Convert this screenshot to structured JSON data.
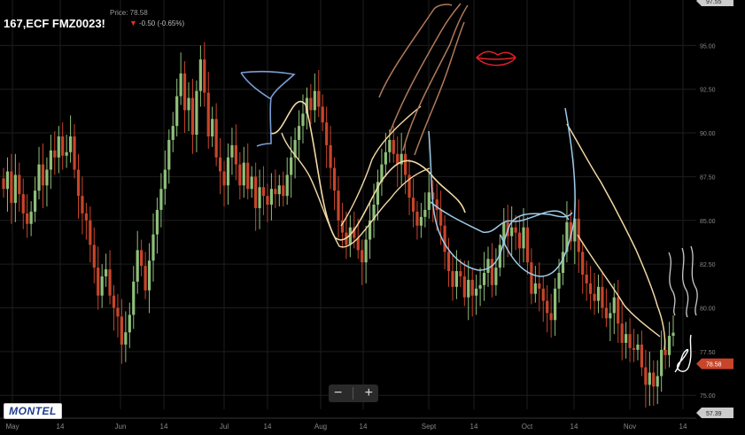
{
  "header": {
    "title": "167,ECF FMZ0023!",
    "price_label": "Price: 78.58",
    "change_text": "-0.50 (-0.65%)",
    "change_arrow": "down-arrow-icon"
  },
  "zoom": {
    "minus": "−",
    "plus": "+"
  },
  "logo": {
    "text": "MONTEL"
  },
  "colors": {
    "up": "#8fbf7a",
    "down": "#c8452a",
    "grid": "#1e1e1e",
    "axis_text": "#888"
  },
  "chart_data": {
    "type": "candlestick",
    "title": "167,ECF FMZ0023!",
    "y_ticks": [
      "95.00",
      "92.50",
      "90.00",
      "87.50",
      "85.00",
      "82.50",
      "80.00",
      "77.50",
      "75.00"
    ],
    "ylim": [
      74.2,
      97.6
    ],
    "x_tick_labels": [
      "May",
      "14",
      "Jun",
      "14",
      "Jul",
      "14",
      "Aug",
      "14",
      "Sept",
      "14",
      "Oct",
      "14",
      "Nov",
      "14"
    ],
    "price_flags": [
      {
        "label": "97.55",
        "value": 97.55,
        "color": "#cccccc"
      },
      {
        "label": "78.58",
        "value": 76.8,
        "color": "#c8452a"
      },
      {
        "label": "57.39",
        "value": 74.0,
        "color": "#cccccc"
      }
    ],
    "closes": [
      86.8,
      87.8,
      86.0,
      87.6,
      86.5,
      85.4,
      84.8,
      85.5,
      86.7,
      88.2,
      87.0,
      87.9,
      89.0,
      88.6,
      89.8,
      88.7,
      88.9,
      89.8,
      87.9,
      86.4,
      85.4,
      85.0,
      83.6,
      82.3,
      80.7,
      81.8,
      82.2,
      80.7,
      80.0,
      79.5,
      77.9,
      78.6,
      79.6,
      81.5,
      83.3,
      82.4,
      81.0,
      82.7,
      84.2,
      85.6,
      86.8,
      87.9,
      89.6,
      90.4,
      92.1,
      93.4,
      91.3,
      92.0,
      89.9,
      92.4,
      94.2,
      92.3,
      89.8,
      90.8,
      88.6,
      87.8,
      87.0,
      88.6,
      89.3,
      88.2,
      87.0,
      88.3,
      86.8,
      87.5,
      85.7,
      86.9,
      86.4,
      85.9,
      86.8,
      86.5,
      87.0,
      86.4,
      87.6,
      88.6,
      89.6,
      90.4,
      91.1,
      92.0,
      91.3,
      92.4,
      91.5,
      90.6,
      89.3,
      88.0,
      86.7,
      85.0,
      84.3,
      83.6,
      84.6,
      84.0,
      83.3,
      82.6,
      83.9,
      85.0,
      85.9,
      87.2,
      88.2,
      88.9,
      89.6,
      88.8,
      88.2,
      88.8,
      87.6,
      86.3,
      85.5,
      84.7,
      85.2,
      85.6,
      86.6,
      86.2,
      85.6,
      84.7,
      83.2,
      82.1,
      81.2,
      82.1,
      81.8,
      80.6,
      81.6,
      80.7,
      81.1,
      81.3,
      82.0,
      82.8,
      81.3,
      82.3,
      83.6,
      84.9,
      84.1,
      84.6,
      84.3,
      83.4,
      84.6,
      82.6,
      80.8,
      81.4,
      81.1,
      80.4,
      79.7,
      79.3,
      81.1,
      82.0,
      83.2,
      84.9,
      83.8,
      85.1,
      83.2,
      81.9,
      81.4,
      80.8,
      80.4,
      81.2,
      80.0,
      79.4,
      79.7,
      80.6,
      79.1,
      78.0,
      78.5,
      77.7,
      77.6,
      77.9,
      76.6,
      75.6,
      76.3,
      75.5,
      76.1,
      77.6,
      77.3,
      78.4,
      78.58
    ],
    "overlay_annotations": "hand-drawn freehand marker strokes (beige, blue, light blue, brown, red, white) over the candles"
  }
}
